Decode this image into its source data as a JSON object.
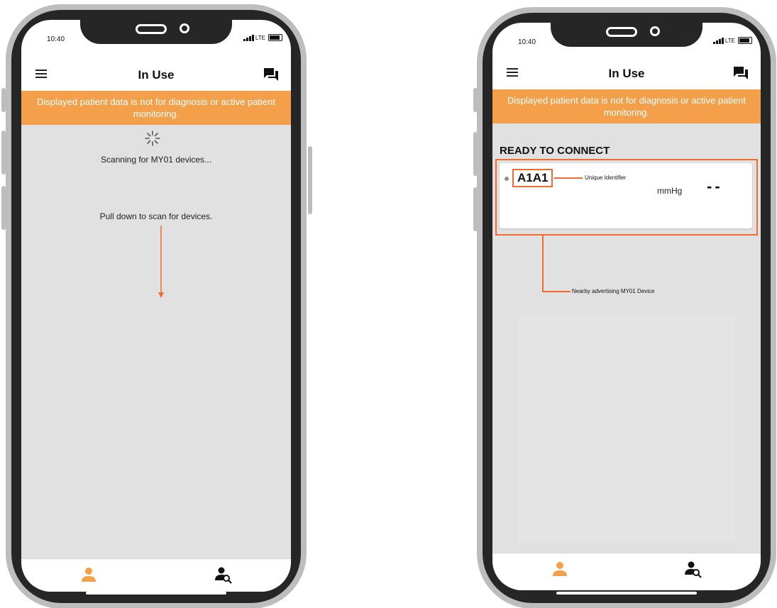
{
  "status_bar": {
    "time": "10:40",
    "network": "LTE"
  },
  "navbar": {
    "title": "In Use"
  },
  "banner": {
    "text": "Displayed patient data is not for diagnosis or active patient monitoring."
  },
  "scanning_screen": {
    "scan_text": "Scanning for MY01 devices...",
    "pull_text": "Pull down to scan for devices."
  },
  "device_screen": {
    "section_title": "READY TO CONNECT",
    "device": {
      "id": "A1A1",
      "unit": "mmHg",
      "value": "--"
    },
    "annotations": {
      "identifier": "Unique Identifier",
      "device": "Nearby advertising MY01 Device"
    }
  },
  "tabs": [
    {
      "icon": "person-icon",
      "active": true
    },
    {
      "icon": "person-search-icon",
      "active": false
    }
  ],
  "colors": {
    "accent": "#f4a04a",
    "highlight": "#f26a2e",
    "content_bg": "#e1e1e1",
    "frame": "#262626"
  }
}
